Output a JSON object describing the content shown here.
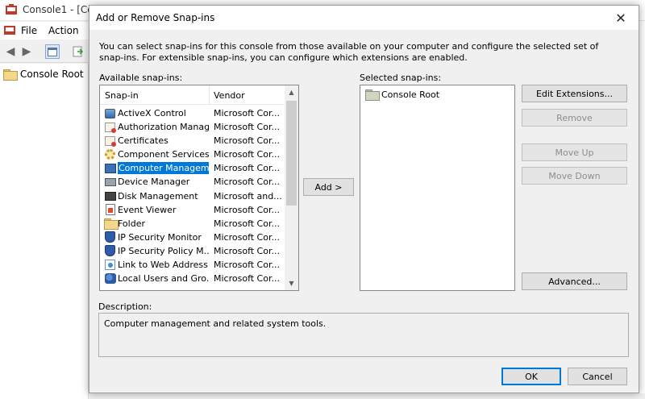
{
  "mmc": {
    "title": "Console1 - [Co",
    "menu": [
      "File",
      "Action"
    ],
    "tree_root": "Console Root"
  },
  "dialog": {
    "title": "Add or Remove Snap-ins",
    "intro": "You can select snap-ins for this console from those available on your computer and configure the selected set of snap-ins. For extensible snap-ins, you can configure which extensions are enabled.",
    "available_label": "Available snap-ins:",
    "selected_label": "Selected snap-ins:",
    "columns": {
      "snapin": "Snap-in",
      "vendor": "Vendor"
    },
    "snapins": [
      {
        "name": "ActiveX Control",
        "vendor": "Microsoft Cor...",
        "icon": "activex-icon"
      },
      {
        "name": "Authorization Manager",
        "vendor": "Microsoft Cor...",
        "icon": "authorization-icon"
      },
      {
        "name": "Certificates",
        "vendor": "Microsoft Cor...",
        "icon": "certificate-icon"
      },
      {
        "name": "Component Services",
        "vendor": "Microsoft Cor...",
        "icon": "component-icon"
      },
      {
        "name": "Computer Managem...",
        "vendor": "Microsoft Cor...",
        "icon": "computer-management-icon",
        "selected": true
      },
      {
        "name": "Device Manager",
        "vendor": "Microsoft Cor...",
        "icon": "device-icon"
      },
      {
        "name": "Disk Management",
        "vendor": "Microsoft and...",
        "icon": "disk-icon"
      },
      {
        "name": "Event Viewer",
        "vendor": "Microsoft Cor...",
        "icon": "event-viewer-icon"
      },
      {
        "name": "Folder",
        "vendor": "Microsoft Cor...",
        "icon": "folder-icon"
      },
      {
        "name": "IP Security Monitor",
        "vendor": "Microsoft Cor...",
        "icon": "ip-security-icon"
      },
      {
        "name": "IP Security Policy M...",
        "vendor": "Microsoft Cor...",
        "icon": "ip-security-icon"
      },
      {
        "name": "Link to Web Address",
        "vendor": "Microsoft Cor...",
        "icon": "link-icon"
      },
      {
        "name": "Local Users and Gro...",
        "vendor": "Microsoft Cor...",
        "icon": "users-icon"
      }
    ],
    "selected_items": [
      "Console Root"
    ],
    "buttons": {
      "add": "Add >",
      "edit_extensions": "Edit Extensions...",
      "remove": "Remove",
      "move_up": "Move Up",
      "move_down": "Move Down",
      "advanced": "Advanced...",
      "ok": "OK",
      "cancel": "Cancel"
    },
    "description_label": "Description:",
    "description": "Computer management and related system tools."
  }
}
